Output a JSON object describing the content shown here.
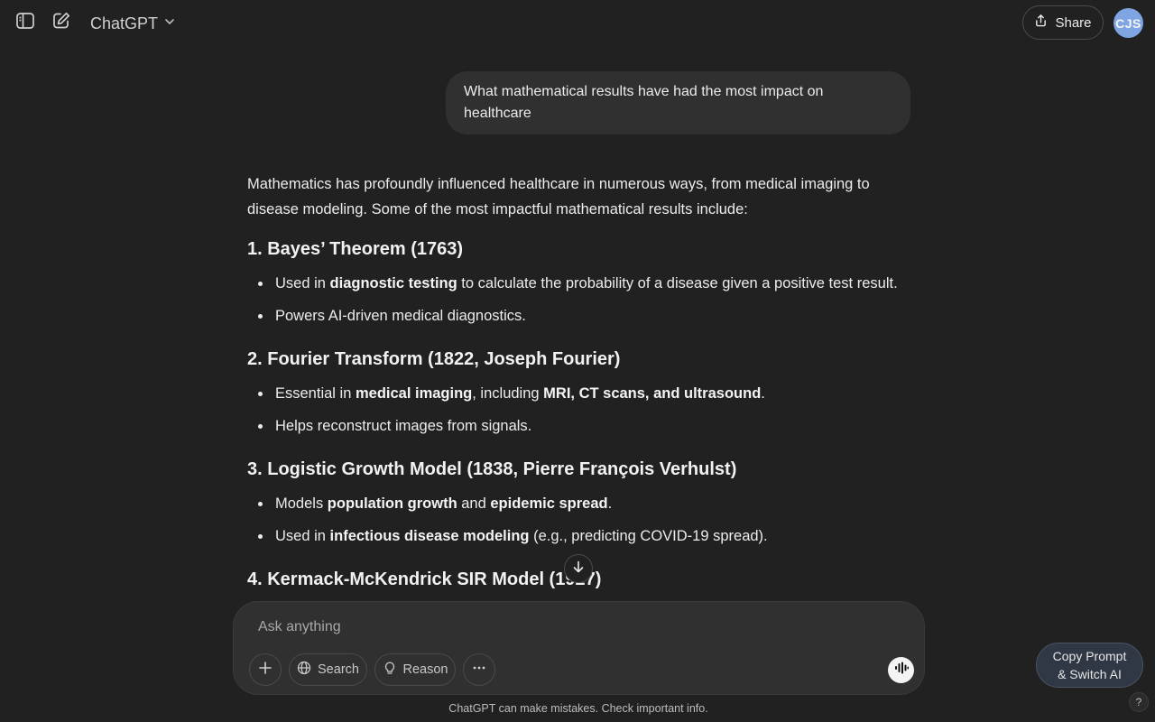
{
  "header": {
    "model_name": "ChatGPT",
    "share_label": "Share",
    "avatar_initials": "CJS"
  },
  "conversation": {
    "user_message": "What mathematical results have had the most impact on healthcare",
    "assistant": {
      "intro": "Mathematics has profoundly influenced healthcare in numerous ways, from medical imaging to disease modeling. Some of the most impactful mathematical results include:",
      "sections": [
        {
          "heading": "1. Bayes’ Theorem (1763)",
          "bullets": [
            [
              {
                "t": "Used in "
              },
              {
                "t": "diagnostic testing",
                "b": true
              },
              {
                "t": " to calculate the probability of a disease given a positive test result."
              }
            ],
            [
              {
                "t": "Powers AI-driven medical diagnostics."
              }
            ]
          ]
        },
        {
          "heading": "2. Fourier Transform (1822, Joseph Fourier)",
          "bullets": [
            [
              {
                "t": "Essential in "
              },
              {
                "t": "medical imaging",
                "b": true
              },
              {
                "t": ", including "
              },
              {
                "t": "MRI, CT scans, and ultrasound",
                "b": true
              },
              {
                "t": "."
              }
            ],
            [
              {
                "t": "Helps reconstruct images from signals."
              }
            ]
          ]
        },
        {
          "heading": "3. Logistic Growth Model (1838, Pierre François Verhulst)",
          "bullets": [
            [
              {
                "t": "Models "
              },
              {
                "t": "population growth",
                "b": true
              },
              {
                "t": " and "
              },
              {
                "t": "epidemic spread",
                "b": true
              },
              {
                "t": "."
              }
            ],
            [
              {
                "t": "Used in "
              },
              {
                "t": "infectious disease modeling",
                "b": true
              },
              {
                "t": " (e.g., predicting COVID-19 spread)."
              }
            ]
          ]
        },
        {
          "heading": "4. Kermack-McKendrick SIR Model (1927)",
          "bullets": []
        }
      ]
    }
  },
  "composer": {
    "placeholder": "Ask anything",
    "search_label": "Search",
    "reason_label": "Reason"
  },
  "disclaimer": "ChatGPT can make mistakes. Check important info.",
  "extension": {
    "copy_prompt_line1": "Copy Prompt",
    "copy_prompt_line2": "& Switch AI"
  },
  "help_label": "?"
}
